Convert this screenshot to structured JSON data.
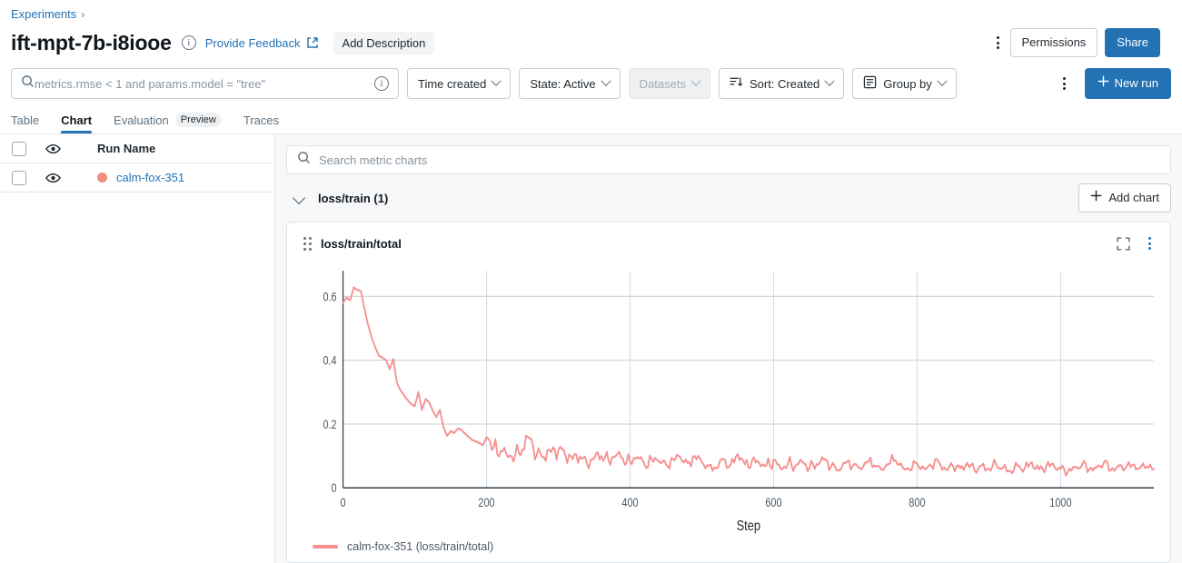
{
  "breadcrumb": {
    "root": "Experiments",
    "separator": "›"
  },
  "header": {
    "title": "ift-mpt-7b-i8iooe",
    "info_icon": "info-circle-icon",
    "feedback_link": "Provide Feedback",
    "external_link_icon": "external-link-icon",
    "add_description": "Add Description",
    "overflow_icon": "kebab-menu-icon",
    "permissions": "Permissions",
    "share": "Share"
  },
  "filters": {
    "search_placeholder": "metrics.rmse < 1 and params.model = \"tree\"",
    "search_value": "",
    "search_icon": "search-icon",
    "search_info_icon": "info-circle-icon",
    "time_created": "Time created",
    "state": "State: Active",
    "datasets": "Datasets",
    "sort": "Sort: Created",
    "sort_icon": "sort-descending-icon",
    "group_by": "Group by",
    "group_by_icon": "list-icon",
    "overflow_icon": "kebab-menu-icon",
    "new_run": "New run",
    "new_run_icon": "plus-icon"
  },
  "tabs": [
    {
      "label": "Table",
      "active": false,
      "badge": ""
    },
    {
      "label": "Chart",
      "active": true,
      "badge": ""
    },
    {
      "label": "Evaluation",
      "active": false,
      "badge": "Preview"
    },
    {
      "label": "Traces",
      "active": false,
      "badge": ""
    }
  ],
  "runs_table": {
    "header": {
      "checkbox": "select-all",
      "visibility_icon": "eye-icon",
      "run_name": "Run Name"
    },
    "rows": [
      {
        "checked": false,
        "visibility_icon": "eye-icon",
        "color": "#F28B82",
        "name": "calm-fox-351"
      }
    ]
  },
  "charts_panel": {
    "search_placeholder": "Search metric charts",
    "search_value": "",
    "search_icon": "search-icon",
    "section": {
      "title": "loss/train (1)",
      "collapse_icon": "chevron-down-icon"
    },
    "add_chart": "Add chart",
    "add_chart_icon": "plus-icon",
    "card": {
      "title": "loss/train/total",
      "drag_icon": "drag-handle-icon",
      "expand_icon": "fullscreen-icon",
      "overflow_icon": "kebab-menu-icon"
    }
  },
  "colors": {
    "accent_blue": "#2272B4",
    "series_pink": "#F68F8F",
    "grid": "#CFD8DF",
    "axis": "#33414D",
    "panel_bg": "#F7F8FA"
  },
  "chart_data": {
    "type": "line",
    "title": "loss/train/total",
    "xlabel": "Step",
    "ylabel": "",
    "xlim": [
      0,
      1130
    ],
    "ylim": [
      0,
      0.68
    ],
    "xticks": [
      0,
      200,
      400,
      600,
      800,
      1000
    ],
    "yticks": [
      0,
      0.2,
      0.4,
      0.6
    ],
    "grid": true,
    "legend_position": "bottom-left",
    "series": [
      {
        "name": "calm-fox-351 (loss/train/total)",
        "color": "#F68F8F",
        "x": [
          0,
          5,
          10,
          15,
          20,
          25,
          30,
          35,
          40,
          45,
          50,
          55,
          60,
          65,
          70,
          75,
          80,
          85,
          90,
          95,
          100,
          105,
          110,
          115,
          120,
          125,
          130,
          135,
          140,
          145,
          150,
          155,
          160,
          165,
          170,
          175,
          180,
          185,
          190,
          195,
          200,
          210,
          220,
          230,
          240,
          250,
          260,
          270,
          280,
          290,
          300,
          310,
          320,
          330,
          340,
          350,
          360,
          370,
          380,
          390,
          400,
          410,
          420,
          430,
          440,
          450,
          460,
          470,
          480,
          490,
          500,
          510,
          520,
          530,
          540,
          550,
          560,
          570,
          580,
          590,
          600,
          610,
          620,
          630,
          640,
          650,
          660,
          670,
          680,
          690,
          700,
          710,
          720,
          730,
          740,
          750,
          760,
          770,
          780,
          790,
          800,
          810,
          820,
          830,
          840,
          850,
          860,
          870,
          880,
          890,
          900,
          910,
          920,
          930,
          940,
          950,
          960,
          970,
          980,
          990,
          1000,
          1010,
          1020,
          1030,
          1040,
          1050,
          1060,
          1070,
          1080,
          1090,
          1100,
          1110,
          1120,
          1130
        ],
        "y": [
          0.58,
          0.596,
          0.588,
          0.628,
          0.62,
          0.616,
          0.56,
          0.51,
          0.47,
          0.44,
          0.414,
          0.408,
          0.4,
          0.372,
          0.404,
          0.33,
          0.306,
          0.29,
          0.275,
          0.262,
          0.256,
          0.3,
          0.244,
          0.278,
          0.268,
          0.242,
          0.222,
          0.244,
          0.19,
          0.163,
          0.178,
          0.172,
          0.186,
          0.182,
          0.17,
          0.16,
          0.15,
          0.146,
          0.14,
          0.134,
          0.158,
          0.128,
          0.116,
          0.096,
          0.104,
          0.12,
          0.155,
          0.104,
          0.096,
          0.112,
          0.118,
          0.102,
          0.09,
          0.098,
          0.074,
          0.092,
          0.1,
          0.086,
          0.1,
          0.092,
          0.082,
          0.096,
          0.074,
          0.09,
          0.084,
          0.074,
          0.09,
          0.096,
          0.078,
          0.1,
          0.08,
          0.07,
          0.062,
          0.09,
          0.072,
          0.106,
          0.074,
          0.086,
          0.078,
          0.07,
          0.086,
          0.06,
          0.076,
          0.068,
          0.082,
          0.062,
          0.074,
          0.09,
          0.066,
          0.056,
          0.078,
          0.068,
          0.062,
          0.08,
          0.07,
          0.058,
          0.074,
          0.086,
          0.064,
          0.056,
          0.076,
          0.06,
          0.068,
          0.082,
          0.058,
          0.068,
          0.062,
          0.078,
          0.056,
          0.07,
          0.06,
          0.074,
          0.064,
          0.052,
          0.07,
          0.062,
          0.08,
          0.058,
          0.068,
          0.074,
          0.06,
          0.05,
          0.066,
          0.072,
          0.058,
          0.064,
          0.078,
          0.056,
          0.068,
          0.06,
          0.072,
          0.062,
          0.066,
          0.058
        ]
      }
    ]
  }
}
